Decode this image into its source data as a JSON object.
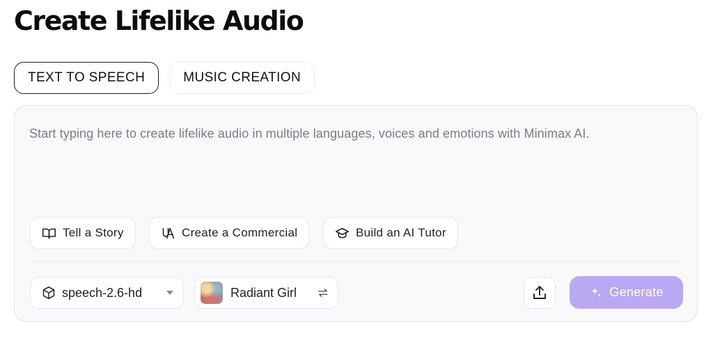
{
  "page": {
    "title": "Create Lifelike Audio"
  },
  "tabs": [
    {
      "label": "TEXT TO SPEECH",
      "active": true
    },
    {
      "label": "MUSIC CREATION",
      "active": false
    }
  ],
  "composer": {
    "placeholder": "Start typing here to create lifelike audio in multiple languages, voices and emotions with Minimax AI.",
    "suggestions": [
      {
        "label": "Tell a Story",
        "icon": "book-icon"
      },
      {
        "label": "Create a Commercial",
        "icon": "commercial-icon"
      },
      {
        "label": "Build an AI Tutor",
        "icon": "graduation-cap-icon"
      }
    ],
    "model": {
      "value": "speech-2.6-hd",
      "icon": "cube-icon"
    },
    "voice": {
      "name": "Radiant Girl",
      "icon": "swap-icon"
    },
    "generate_label": "Generate"
  },
  "colors": {
    "accent": "#bba8f3",
    "text": "#111111",
    "muted": "#7c7c84"
  }
}
